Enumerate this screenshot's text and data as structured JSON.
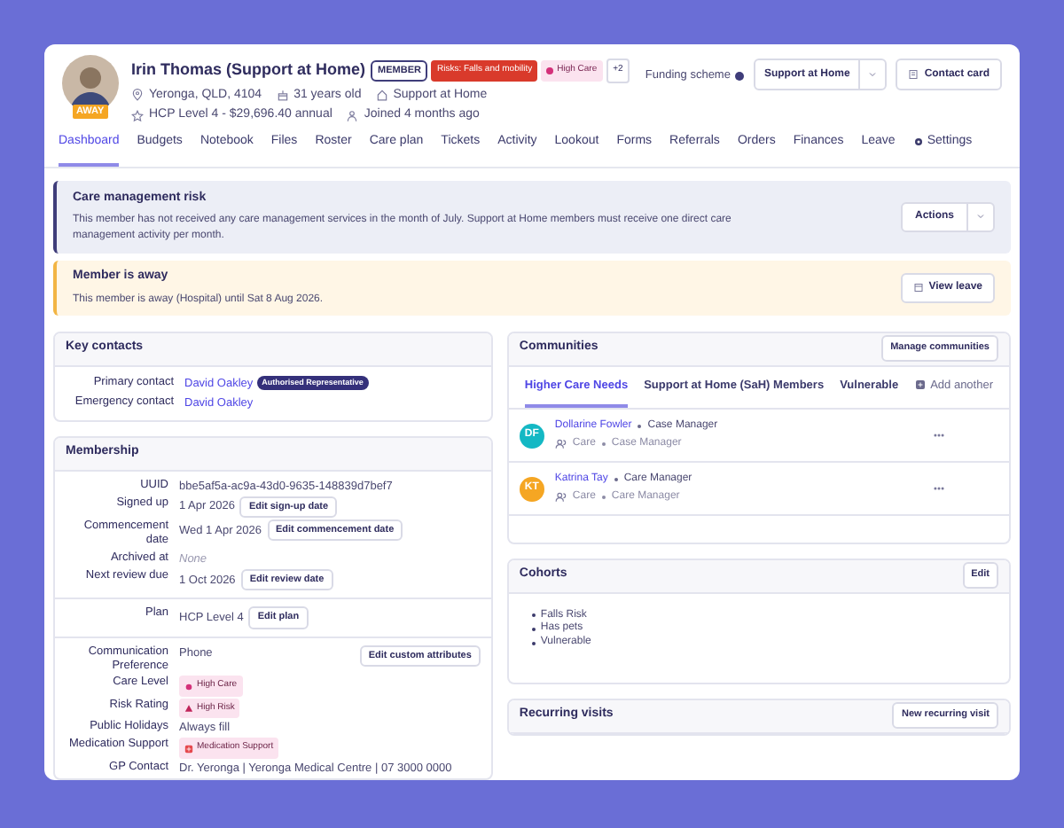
{
  "header": {
    "name": "Irin Thomas (Support at Home)",
    "role_badge": "MEMBER",
    "status_badge": "AWAY",
    "tags": [
      {
        "label": "Risks: Falls and mobility",
        "kind": "risk"
      },
      {
        "label": "High Care",
        "kind": "care"
      },
      {
        "label": "+2",
        "kind": "more"
      }
    ],
    "details": [
      "Yeronga, QLD, 4104",
      "31 years old",
      "Support at Home",
      "HCP Level 4 - $29,696.40 annual",
      "Joined 4 months ago"
    ],
    "funding_label": "Funding scheme",
    "funding_value": "Support at Home",
    "contact_button": "Contact card"
  },
  "tabs": [
    {
      "label": "Dashboard",
      "selected": true,
      "kind": "text"
    },
    {
      "label": "Budgets",
      "selected": false,
      "kind": "text"
    },
    {
      "label": "Notebook",
      "selected": false,
      "kind": "text"
    },
    {
      "label": "Files",
      "selected": false,
      "kind": "text"
    },
    {
      "label": "Roster",
      "selected": false,
      "kind": "text"
    },
    {
      "label": "Care plan",
      "selected": false,
      "kind": "text"
    },
    {
      "label": "Tickets",
      "selected": false,
      "kind": "text"
    },
    {
      "label": "Activity",
      "selected": false,
      "kind": "text"
    },
    {
      "label": "Lookout",
      "selected": false,
      "kind": "text"
    },
    {
      "label": "Forms",
      "selected": false,
      "kind": "text"
    },
    {
      "label": "Referrals",
      "selected": false,
      "kind": "text"
    },
    {
      "label": "Orders",
      "selected": false,
      "kind": "text"
    },
    {
      "label": "Finances",
      "selected": false,
      "kind": "text"
    },
    {
      "label": "Leave",
      "selected": false,
      "kind": "text"
    },
    {
      "label": "Settings",
      "selected": false,
      "kind": "settings"
    }
  ],
  "alerts": [
    {
      "kind": "risk",
      "title": "Care management risk",
      "text": "This member has not received any care management services in the month of July. Support at Home members must receive one direct care management activity per month.",
      "action": "Actions"
    },
    {
      "kind": "away",
      "title": "Member is away",
      "text": "This member is away (Hospital) until Sat 8 Aug 2026.",
      "action": "View leave"
    }
  ],
  "key_contacts": {
    "title": "Key contacts",
    "rows": [
      {
        "label": "Primary contact",
        "value": "David Oakley",
        "badge": "Authorised Representative"
      },
      {
        "label": "Emergency contact",
        "value": "David Oakley"
      }
    ]
  },
  "membership": {
    "title": "Membership",
    "sections": [
      {
        "rows": [
          {
            "label": "UUID",
            "value": "bbe5af5a-ac9a-43d0-9635-148839d7bef7",
            "kind": "text"
          },
          {
            "label": "Signed up",
            "value": "1 Apr 2026",
            "kind": "text",
            "button": "Edit sign-up date"
          },
          {
            "label": "Commencement date",
            "value": "Wed 1 Apr 2026",
            "kind": "text",
            "button": "Edit commencement date"
          },
          {
            "label": "Archived at",
            "value": "None",
            "kind": "empty"
          },
          {
            "label": "Next review due",
            "value": "1 Oct 2026",
            "kind": "text",
            "button": "Edit review date"
          }
        ]
      },
      {
        "rows": [
          {
            "label": "Plan",
            "value": "HCP Level 4",
            "kind": "text",
            "button": "Edit plan"
          }
        ]
      },
      {
        "action": "Edit custom attributes",
        "rows": [
          {
            "label": "Communication Preference",
            "value": "Phone",
            "kind": "text"
          },
          {
            "label": "Care Level",
            "value": "High Care",
            "kind": "care"
          },
          {
            "label": "Risk Rating",
            "value": "High Risk",
            "kind": "risk"
          },
          {
            "label": "Public Holidays",
            "value": "Always fill",
            "kind": "text"
          },
          {
            "label": "Medication Support",
            "value": "Medication Support",
            "kind": "medication"
          },
          {
            "label": "GP Contact",
            "value": "Dr. Yeronga | Yeronga Medical Centre | 07 3000 0000",
            "kind": "text"
          }
        ]
      }
    ]
  },
  "communities": {
    "title": "Communities",
    "button": "Manage communities",
    "tabs": [
      {
        "label": "Higher Care Needs",
        "selected": true
      },
      {
        "label": "Support at Home (SaH) Members",
        "selected": false
      },
      {
        "label": "Vulnerable",
        "selected": false
      }
    ],
    "add_tab": "Add another",
    "members": [
      {
        "initials": "DF",
        "name": "Dollarine Fowler",
        "role": "Case Manager",
        "team": "Care",
        "team_role": "Case Manager",
        "color": "#14b8c4"
      },
      {
        "initials": "KT",
        "name": "Katrina Tay",
        "role": "Care Manager",
        "team": "Care",
        "team_role": "Care Manager",
        "color": "#f5a623"
      }
    ]
  },
  "cohorts": {
    "title": "Cohorts",
    "button": "Edit",
    "items": [
      "Falls Risk",
      "Has pets",
      "Vulnerable"
    ]
  },
  "recurring_visits": {
    "title": "Recurring visits",
    "button": "New recurring visit"
  }
}
